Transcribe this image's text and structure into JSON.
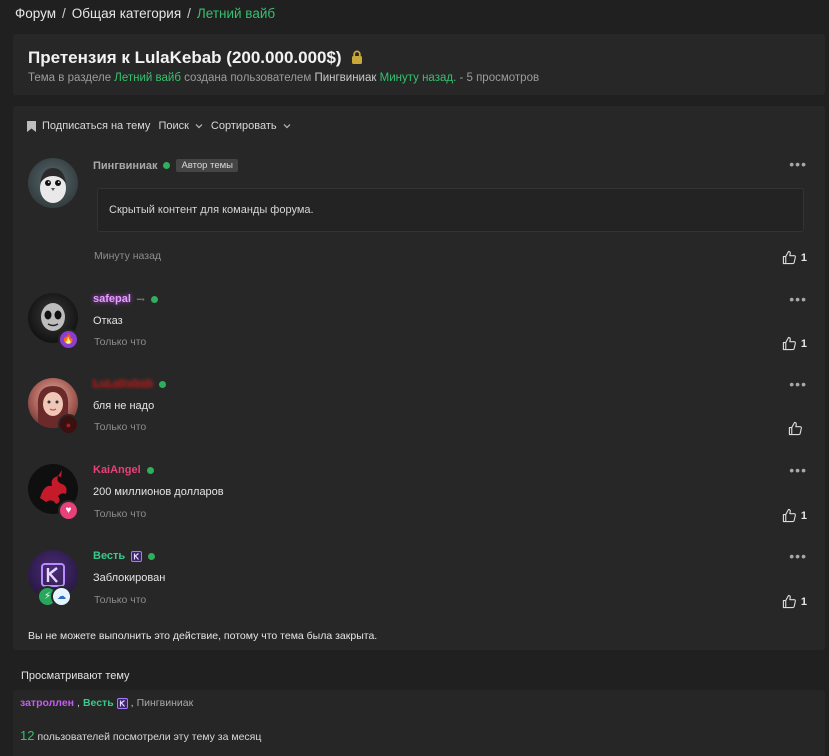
{
  "breadcrumb": {
    "items": [
      "Форум",
      "Общая категория",
      "Летний вайб"
    ],
    "separator": "/"
  },
  "thread": {
    "title": "Претензия к LulaKebab (200.000.000$)",
    "meta": {
      "prefix": "Тема в разделе",
      "section": "Летний вайб",
      "mid": "создана пользователем",
      "author": "Пингвиниак",
      "time": "Минуту назад.",
      "views": "- 5 просмотров"
    }
  },
  "toolbar": {
    "subscribe": "Подписаться на тему",
    "search": "Поиск",
    "sort": "Сортировать"
  },
  "posts": [
    {
      "username": "Пингвиниак",
      "role": "Автор темы",
      "text": "Скрытый контент для команды форума.",
      "time": "Минуту назад",
      "likes": "1",
      "name_color": "#a9a9a9"
    },
    {
      "username": "safepal",
      "text": "Отказ",
      "time": "Только что",
      "likes": "1",
      "name_color": "#e79bff"
    },
    {
      "username": "LuLaKebab",
      "text": "бля не надо",
      "time": "Только что",
      "likes": "",
      "name_color": "#8a1f1f"
    },
    {
      "username": "KaiAngel",
      "text": "200 миллионов долларов",
      "time": "Только что",
      "likes": "1",
      "name_color": "#e8417a"
    },
    {
      "username": "Весть",
      "text": "Заблокирован",
      "time": "Только что",
      "likes": "1",
      "name_color": "#3ac98a"
    }
  ],
  "closed_notice": "Вы не можете выполнить это действие, потому что тема была закрыта.",
  "viewers": {
    "title": "Просматривают тему",
    "users": [
      {
        "name": "затроллен",
        "color": "#c65cf0"
      },
      {
        "name": "Весть",
        "color": "#3ac98a"
      },
      {
        "name": "Пингвиниак",
        "color": "#a9a9a9"
      }
    ],
    "separator": ",",
    "month_count": "12",
    "month_text": "пользователей посмотрели эту тему за месяц"
  },
  "colors": {
    "accent": "#34c26e",
    "online": "#2fae5d",
    "background": "#202020",
    "card": "#272727"
  },
  "icons": [
    "lock-icon",
    "bookmark-icon",
    "chevron-down-icon",
    "more-icon",
    "thumbs-up-icon",
    "fire-icon",
    "heart-icon",
    "bolt-icon"
  ]
}
